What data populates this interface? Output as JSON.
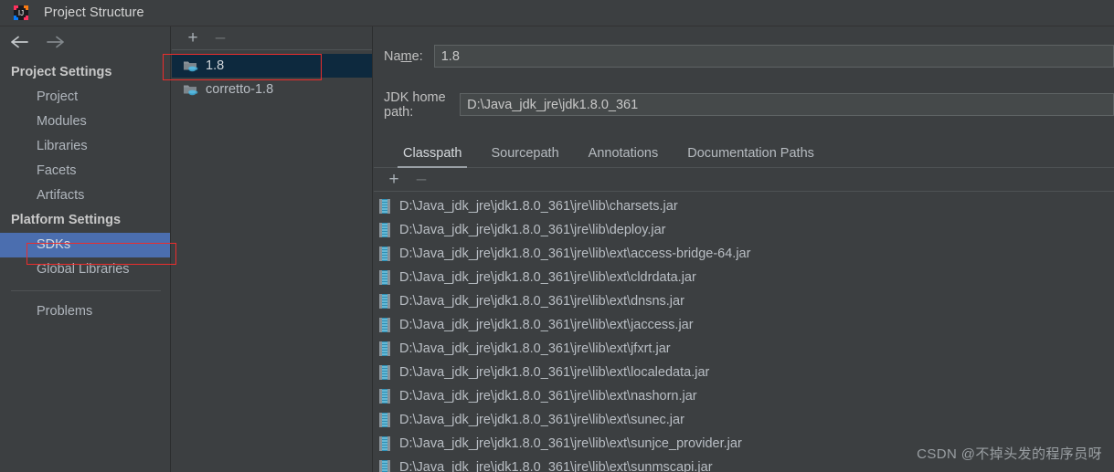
{
  "window": {
    "title": "Project Structure",
    "app_icon": "intellij-idea-icon"
  },
  "nav": {
    "back_icon": "arrow-left-icon",
    "forward_icon": "arrow-right-icon"
  },
  "sidebar": {
    "groups": [
      {
        "label": "Project Settings",
        "items": [
          {
            "label": "Project",
            "selected": false
          },
          {
            "label": "Modules",
            "selected": false
          },
          {
            "label": "Libraries",
            "selected": false
          },
          {
            "label": "Facets",
            "selected": false
          },
          {
            "label": "Artifacts",
            "selected": false
          }
        ]
      },
      {
        "label": "Platform Settings",
        "items": [
          {
            "label": "SDKs",
            "selected": true
          },
          {
            "label": "Global Libraries",
            "selected": false
          }
        ]
      }
    ],
    "footer_items": [
      {
        "label": "Problems",
        "selected": false
      }
    ]
  },
  "sdk_panel": {
    "toolbar": {
      "add_label": "+",
      "add_icon": "plus-icon",
      "remove_label": "–",
      "remove_icon": "minus-icon"
    },
    "items": [
      {
        "label": "1.8",
        "icon": "jdk-folder-icon",
        "selected": true
      },
      {
        "label": "corretto-1.8",
        "icon": "jdk-folder-icon",
        "selected": false
      }
    ]
  },
  "detail": {
    "name_label_pre": "Na",
    "name_label_mnemonic": "m",
    "name_label_post": "e:",
    "name_value": "1.8",
    "home_label": "JDK home path:",
    "home_value": "D:\\Java_jdk_jre\\jdk1.8.0_361",
    "tabs": [
      {
        "label": "Classpath",
        "active": true
      },
      {
        "label": "Sourcepath",
        "active": false
      },
      {
        "label": "Annotations",
        "active": false
      },
      {
        "label": "Documentation Paths",
        "active": false
      }
    ],
    "classpath_toolbar": {
      "add_label": "+",
      "add_icon": "plus-icon",
      "remove_label": "–",
      "remove_icon": "minus-icon"
    },
    "classpath_entries": [
      "D:\\Java_jdk_jre\\jdk1.8.0_361\\jre\\lib\\charsets.jar",
      "D:\\Java_jdk_jre\\jdk1.8.0_361\\jre\\lib\\deploy.jar",
      "D:\\Java_jdk_jre\\jdk1.8.0_361\\jre\\lib\\ext\\access-bridge-64.jar",
      "D:\\Java_jdk_jre\\jdk1.8.0_361\\jre\\lib\\ext\\cldrdata.jar",
      "D:\\Java_jdk_jre\\jdk1.8.0_361\\jre\\lib\\ext\\dnsns.jar",
      "D:\\Java_jdk_jre\\jdk1.8.0_361\\jre\\lib\\ext\\jaccess.jar",
      "D:\\Java_jdk_jre\\jdk1.8.0_361\\jre\\lib\\ext\\jfxrt.jar",
      "D:\\Java_jdk_jre\\jdk1.8.0_361\\jre\\lib\\ext\\localedata.jar",
      "D:\\Java_jdk_jre\\jdk1.8.0_361\\jre\\lib\\ext\\nashorn.jar",
      "D:\\Java_jdk_jre\\jdk1.8.0_361\\jre\\lib\\ext\\sunec.jar",
      "D:\\Java_jdk_jre\\jdk1.8.0_361\\jre\\lib\\ext\\sunjce_provider.jar",
      "D:\\Java_jdk_jre\\jdk1.8.0_361\\jre\\lib\\ext\\sunmscapi.jar"
    ]
  },
  "watermark": {
    "text": "CSDN @不掉头发的程序员呀"
  },
  "colors": {
    "window_bg": "#3c3f41",
    "selection_blue": "#4b6eaf",
    "list_selection": "#0d293e",
    "annotation_red": "#ec2d2d",
    "text_primary": "#bbbbbb",
    "jar_icon_teal": "#3c9dc4"
  }
}
